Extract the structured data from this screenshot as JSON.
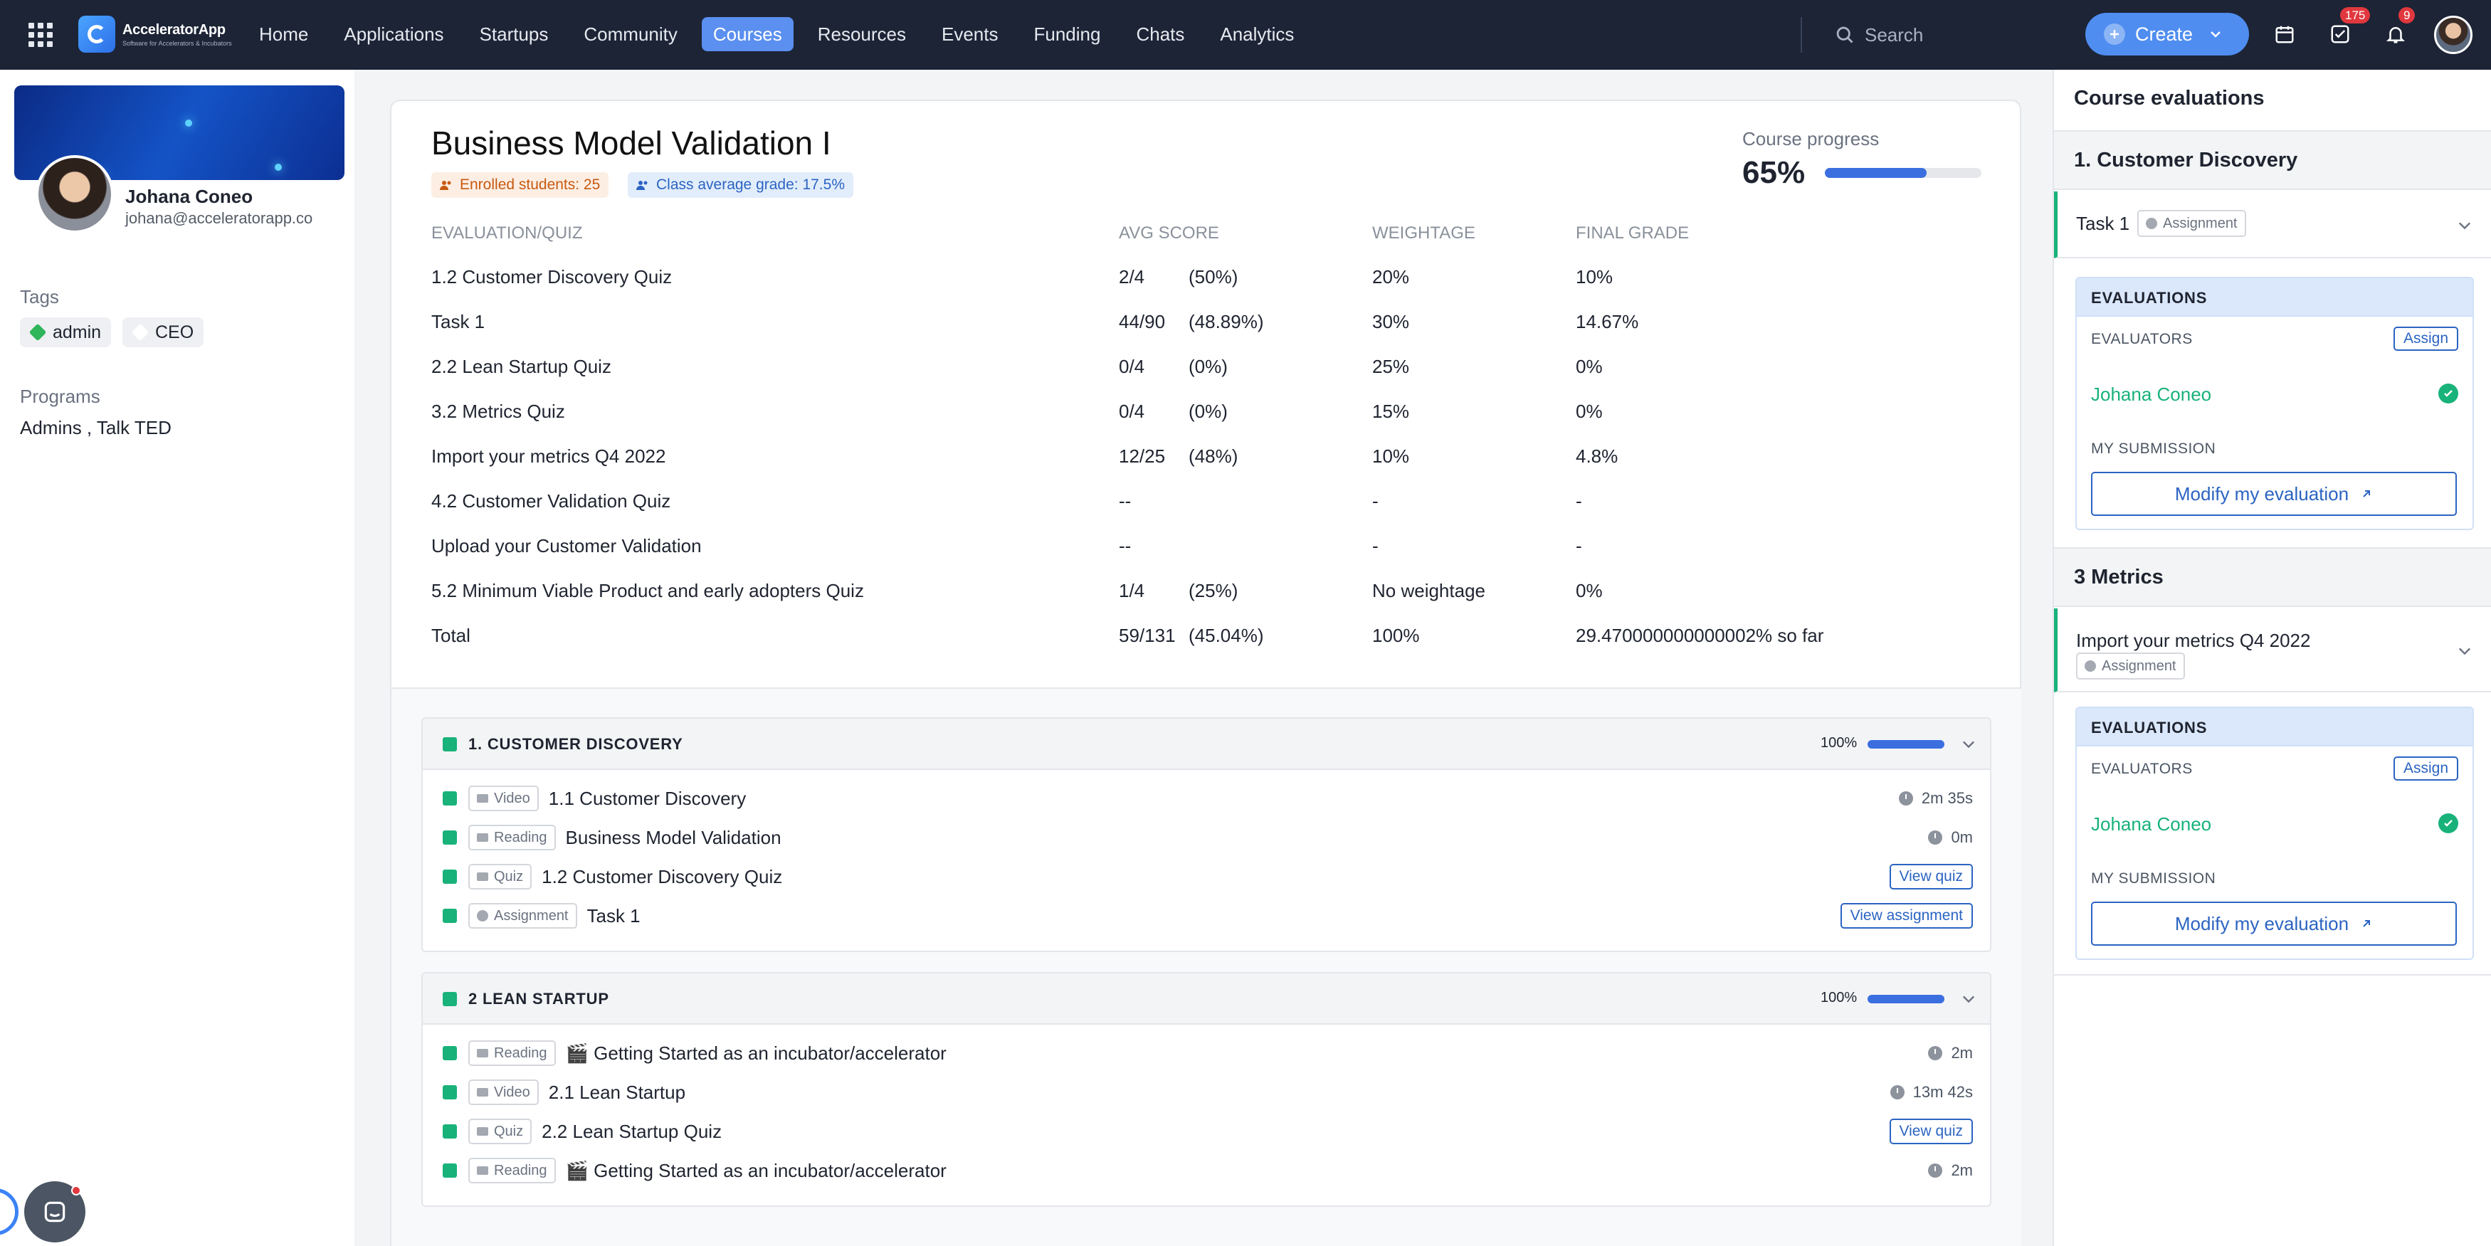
{
  "topbar": {
    "logo_name": "AcceleratorApp",
    "logo_tagline": "Software for Accelerators & Incubators",
    "nav": [
      "Home",
      "Applications",
      "Startups",
      "Community",
      "Courses",
      "Resources",
      "Events",
      "Funding",
      "Chats",
      "Analytics"
    ],
    "active_nav": "Courses",
    "search_placeholder": "Search",
    "create_label": "Create",
    "tasks_badge": "175",
    "notifications_badge": "9"
  },
  "profile": {
    "name": "Johana Coneo",
    "email": "johana@acceleratorapp.co",
    "tags_label": "Tags",
    "tags": [
      "admin",
      "CEO"
    ],
    "programs_label": "Programs",
    "programs": "Admins , Talk TED"
  },
  "course": {
    "title": "Business Model Validation I",
    "enrolled": "Enrolled students: 25",
    "avg_grade": "Class average grade: 17.5%",
    "progress_label": "Course progress",
    "progress_value": "65%",
    "progress_fraction": 0.65
  },
  "grades_table": {
    "headers": [
      "EVALUATION/QUIZ",
      "AVG SCORE",
      "WEIGHTAGE",
      "FINAL GRADE"
    ],
    "rows": [
      {
        "name": "1.2 Customer Discovery Quiz",
        "score": "2/4",
        "pct": "(50%)",
        "weight": "20%",
        "grade": "10%"
      },
      {
        "name": "Task 1",
        "score": "44/90",
        "pct": "(48.89%)",
        "weight": "30%",
        "grade": "14.67%"
      },
      {
        "name": "2.2 Lean Startup Quiz",
        "score": "0/4",
        "pct": "(0%)",
        "weight": "25%",
        "grade": "0%"
      },
      {
        "name": "3.2 Metrics Quiz",
        "score": "0/4",
        "pct": "(0%)",
        "weight": "15%",
        "grade": "0%"
      },
      {
        "name": "Import your metrics Q4 2022",
        "score": "12/25",
        "pct": "(48%)",
        "weight": "10%",
        "grade": "4.8%"
      },
      {
        "name": "4.2 Customer Validation Quiz",
        "score": "--",
        "pct": "",
        "weight": "-",
        "grade": "-"
      },
      {
        "name": "Upload your Customer Validation",
        "score": "--",
        "pct": "",
        "weight": "-",
        "grade": "-"
      },
      {
        "name": "5.2 Minimum Viable Product and early adopters Quiz",
        "score": "1/4",
        "pct": "(25%)",
        "weight": "No weightage",
        "grade": "0%"
      },
      {
        "name": "Total",
        "score": "59/131",
        "pct": "(45.04%)",
        "weight": "100%",
        "grade": "29.470000000000002% so far"
      }
    ]
  },
  "modules": [
    {
      "title": "1. CUSTOMER DISCOVERY",
      "percent": "100%",
      "items": [
        {
          "type": "Video",
          "name": "1.1 Customer Discovery",
          "meta": "2m 35s"
        },
        {
          "type": "Reading",
          "name": "Business Model Validation",
          "meta": "0m"
        },
        {
          "type": "Quiz",
          "name": "1.2 Customer Discovery Quiz",
          "action": "View quiz"
        },
        {
          "type": "Assignment",
          "name": "Task 1",
          "action": "View assignment"
        }
      ]
    },
    {
      "title": "2 LEAN STARTUP",
      "percent": "100%",
      "items": [
        {
          "type": "Reading",
          "name": "🎬 Getting Started as an incubator/accelerator",
          "meta": "2m"
        },
        {
          "type": "Video",
          "name": "2.1 Lean Startup",
          "meta": "13m 42s"
        },
        {
          "type": "Quiz",
          "name": "2.2 Lean Startup Quiz",
          "action": "View quiz"
        },
        {
          "type": "Reading",
          "name": "🎬 Getting Started as an incubator/accelerator",
          "meta": "2m"
        }
      ]
    }
  ],
  "evaluations_panel": {
    "title": "Course evaluations",
    "sections": [
      {
        "heading": "1. Customer Discovery",
        "task": "Task 1",
        "badge": "Assignment",
        "box_title": "EVALUATIONS",
        "evaluators_label": "EVALUATORS",
        "assign_label": "Assign",
        "evaluator": "Johana Coneo",
        "submission_label": "MY SUBMISSION",
        "modify_label": "Modify my evaluation"
      },
      {
        "heading": "3 Metrics",
        "task": "Import your metrics Q4 2022",
        "badge": "Assignment",
        "box_title": "EVALUATIONS",
        "evaluators_label": "EVALUATORS",
        "assign_label": "Assign",
        "evaluator": "Johana Coneo",
        "submission_label": "MY SUBMISSION",
        "modify_label": "Modify my evaluation"
      }
    ]
  }
}
